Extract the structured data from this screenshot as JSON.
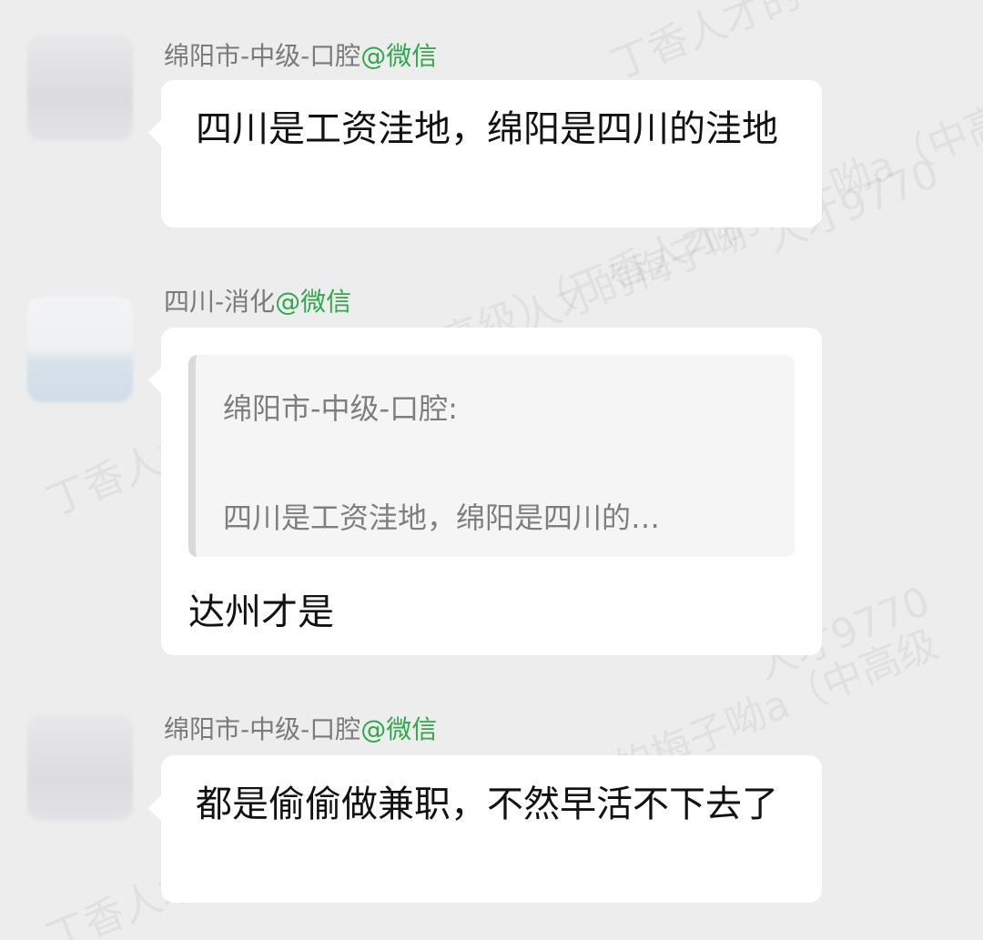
{
  "watermarks": [
    "丁香人才的",
    "人才9770",
    "人才的梅子呦",
    "丁香人才的梅子呦a（中高级）（丁香人才的梅子呦a（中高级",
    "人才9770",
    "丁香人才的梅子呦a（中高级",
    "丁香人才的"
  ],
  "messages": [
    {
      "sender": "绵阳市-中级-口腔",
      "source": "@微信",
      "text": "四川是工资洼地，绵阳是四川的洼地"
    },
    {
      "sender": "四川-消化",
      "source": "@微信",
      "quote_author": "绵阳市-中级-口腔:",
      "quote_preview": "四川是工资洼地，绵阳是四川的…",
      "text": "达州才是"
    },
    {
      "sender": "绵阳市-中级-口腔",
      "source": "@微信",
      "text": "都是偷偷做兼职，不然早活不下去了"
    }
  ]
}
